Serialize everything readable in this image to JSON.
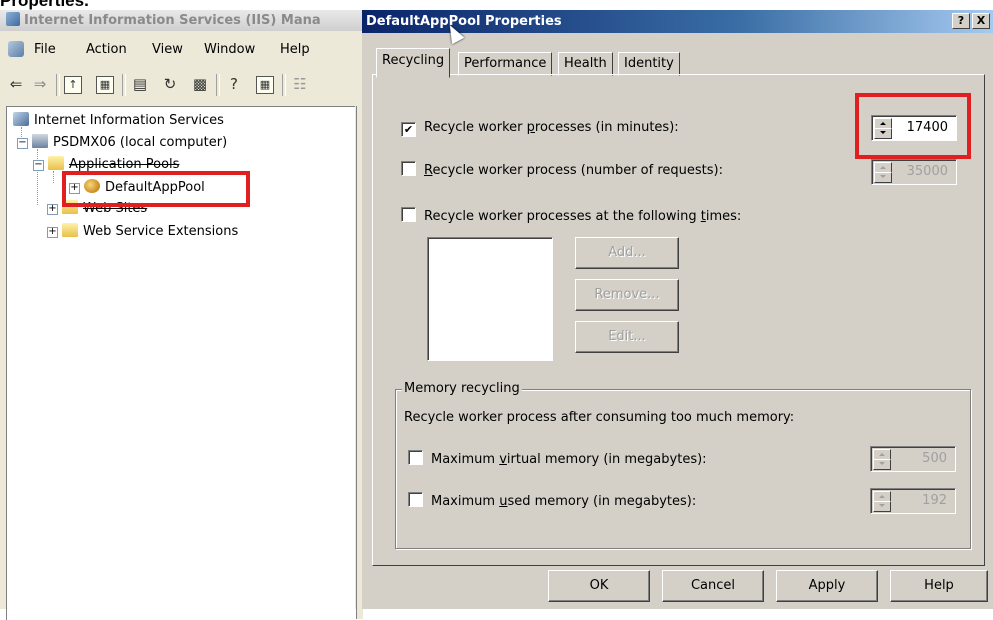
{
  "caption": "Properties.",
  "iis": {
    "title": "Internet Information Services (IIS) Mana",
    "menu": [
      "File",
      "Action",
      "View",
      "Window",
      "Help"
    ],
    "tree": {
      "root": "Internet Information Services",
      "computer": "PSDMX06 (local computer)",
      "app_pools": "Application Pools",
      "pool": "DefaultAppPool",
      "web_sites": "Web Sites",
      "web_ext": "Web Service Extensions"
    }
  },
  "dialog": {
    "title": "DefaultAppPool Properties",
    "help_btn": "?",
    "close_btn": "X",
    "tabs": [
      "Recycling",
      "Performance",
      "Health",
      "Identity"
    ],
    "recycle_minutes": {
      "label_pre": "Recycle worker ",
      "label_u": "p",
      "label_post": "rocesses (in minutes):",
      "checked": true,
      "value": "17400"
    },
    "recycle_requests": {
      "label_pre": "",
      "label_u": "R",
      "label_post": "ecycle worker process (number of requests):",
      "checked": false,
      "value": "35000"
    },
    "recycle_times": {
      "label_pre": "Recycle worker processes at the following ",
      "label_u": "t",
      "label_post": "imes:",
      "checked": false
    },
    "buttons_times": [
      "Add...",
      "Remove...",
      "Edit..."
    ],
    "memory_group": "Memory recycling",
    "memory_desc": "Recycle worker process after consuming too much memory:",
    "virtual_mem": {
      "label_pre": "Maximum ",
      "label_u": "v",
      "label_post": "irtual memory (in megabytes):",
      "checked": false,
      "value": "500"
    },
    "used_mem": {
      "label_pre": "Maximum ",
      "label_u": "u",
      "label_post": "sed memory (in megabytes):",
      "checked": false,
      "value": "192"
    },
    "footer_buttons": [
      "OK",
      "Cancel",
      "Apply",
      "Help"
    ]
  }
}
